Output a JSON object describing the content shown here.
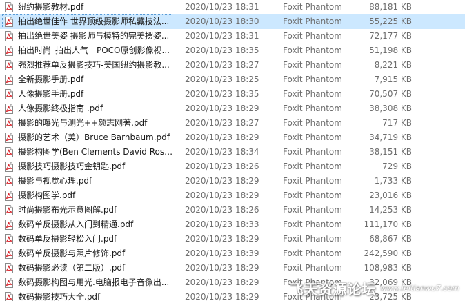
{
  "files": [
    {
      "name": "纽约摄影教材.pdf",
      "modified": "2020/10/23 18:31",
      "type": "Foxit PhantomP...",
      "size": "88,181 KB",
      "selected": false
    },
    {
      "name": "拍出绝世佳作  世界顶级摄影师私藏技法...",
      "modified": "2020/10/23 18:30",
      "type": "Foxit PhantomP...",
      "size": "55,225 KB",
      "selected": true
    },
    {
      "name": "拍出绝世美姿 摄影师与模特的完美摆姿...",
      "modified": "2020/10/23 18:31",
      "type": "Foxit PhantomP...",
      "size": "72,177 KB",
      "selected": false
    },
    {
      "name": "拍出时尚_拍出人气__POCO原创影像视...",
      "modified": "2020/10/23 18:35",
      "type": "Foxit PhantomP...",
      "size": "51,198 KB",
      "selected": false
    },
    {
      "name": "强烈推荐单反摄影技巧-美国纽约摄影教...",
      "modified": "2020/10/23 18:27",
      "type": "Foxit PhantomP...",
      "size": "8,221 KB",
      "selected": false
    },
    {
      "name": "全新摄影手册.pdf",
      "modified": "2020/10/23 18:25",
      "type": "Foxit PhantomP...",
      "size": "7,915 KB",
      "selected": false
    },
    {
      "name": "人像摄影手册.pdf",
      "modified": "2020/10/23 18:35",
      "type": "Foxit PhantomP...",
      "size": "70,507 KB",
      "selected": false
    },
    {
      "name": "人像摄影终极指南 .pdf",
      "modified": "2020/10/23 18:29",
      "type": "Foxit PhantomP...",
      "size": "38,308 KB",
      "selected": false
    },
    {
      "name": "摄影的曝光与测光++颜志刚著.pdf",
      "modified": "2020/10/23 18:27",
      "type": "Foxit PhantomP...",
      "size": "717 KB",
      "selected": false
    },
    {
      "name": "摄影的艺术（美）Bruce Barnbaum.pdf",
      "modified": "2020/10/23 18:29",
      "type": "Foxit PhantomP...",
      "size": "34,719 KB",
      "selected": false
    },
    {
      "name": "摄影构图学(Ben Clements  David Rose...",
      "modified": "2020/10/23 18:34",
      "type": "Foxit PhantomP...",
      "size": "38,151 KB",
      "selected": false
    },
    {
      "name": "摄影技巧摄影技巧金钥匙.pdf",
      "modified": "2020/10/23 18:26",
      "type": "Foxit PhantomP...",
      "size": "729 KB",
      "selected": false
    },
    {
      "name": "摄影与视觉心理.pdf",
      "modified": "2020/10/23 18:29",
      "type": "Foxit PhantomP...",
      "size": "1,733 KB",
      "selected": false
    },
    {
      "name": "摄影构图学.pdf",
      "modified": "2020/10/23 18:29",
      "type": "Foxit PhantomP...",
      "size": "23,016 KB",
      "selected": false
    },
    {
      "name": "时尚摄影布光示意图解.pdf",
      "modified": "2020/10/23 18:26",
      "type": "Foxit PhantomP...",
      "size": "14,253 KB",
      "selected": false
    },
    {
      "name": "数码单反摄影从入门到精通.pdf",
      "modified": "2020/10/23 18:33",
      "type": "Foxit PhantomP...",
      "size": "111,170 KB",
      "selected": false
    },
    {
      "name": "数码单反摄影轻松入门.pdf",
      "modified": "2020/10/23 18:29",
      "type": "Foxit PhantomP...",
      "size": "68,867 KB",
      "selected": false
    },
    {
      "name": "数码单反摄影与照片修饰.pdf",
      "modified": "2020/10/23 18:39",
      "type": "Foxit PhantomP...",
      "size": "242,590 KB",
      "selected": false
    },
    {
      "name": "数码摄影必读（第二版）.pdf",
      "modified": "2020/10/23 18:29",
      "type": "Foxit PhantomP...",
      "size": "108,983 KB",
      "selected": false
    },
    {
      "name": "数码摄影构图与用光.电脑报电子音像出...",
      "modified": "2020/10/23 18:29",
      "type": "Foxit PhantomP...",
      "size": "32,069 KB",
      "selected": false
    },
    {
      "name": "数码摄影技巧大全.pdf",
      "modified": "2020/10/23 18:29",
      "type": "Foxit PhantomP...",
      "size": "23,725 KB",
      "selected": false
    }
  ],
  "watermark": {
    "text": "飞天资源论坛",
    "url": "www.feitianwu7.com"
  },
  "colors": {
    "selection_bg": "#cce8ff",
    "secondary_text": "#6d6d6d",
    "pdf_red": "#d8232a"
  },
  "icons": {
    "file": "pdf-file-icon"
  }
}
